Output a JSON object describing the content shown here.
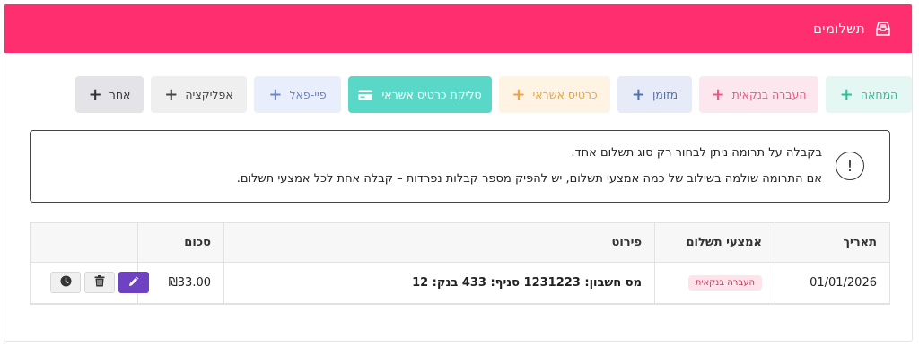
{
  "header": {
    "title": "תשלומים",
    "icon": "inbox-tray-icon",
    "color": "#ff2e6f"
  },
  "payment_buttons": [
    {
      "label": "המחאה",
      "name": "cheque",
      "bg": "#e4f7f3",
      "fg": "#2fbf97"
    },
    {
      "label": "העברה בנקאית",
      "name": "bank-transfer",
      "bg": "#fde7ee",
      "fg": "#e75a86"
    },
    {
      "label": "מזומן",
      "name": "cash",
      "bg": "#e6ebf7",
      "fg": "#5470a8"
    },
    {
      "label": "כרטיס אשראי",
      "name": "credit-card",
      "bg": "#fff4e4",
      "fg": "#e9a448"
    },
    {
      "label": "סליקת כרטיס אשראי",
      "name": "credit-card-clearing",
      "bg": "#59d8c8",
      "fg": "#ffffff"
    },
    {
      "label": "פיי-פאל",
      "name": "paypal",
      "bg": "#e8eefb",
      "fg": "#6f86c9"
    },
    {
      "label": "אפליקציה",
      "name": "app",
      "bg": "#efefef",
      "fg": "#444444"
    },
    {
      "label": "אחר",
      "name": "other",
      "bg": "#e4e4e8",
      "fg": "#333333"
    }
  ],
  "alert": {
    "line1": "בקבלה על תרומה ניתן לבחור רק סוג תשלום אחד.",
    "line2": "אם התרומה שולמה בשילוב של כמה אמצעי תשלום, יש להפיק מספר קבלות נפרדות – קבלה אחת לכל אמצעי תשלום."
  },
  "table": {
    "headers": {
      "date": "תאריך",
      "method": "אמצעי תשלום",
      "detail": "פירוט",
      "sum": "סכום"
    },
    "rows": [
      {
        "date": "01/01/2026",
        "method": "העברה בנקאית",
        "detail": "מס חשבון: 1231223 סניף: 433 בנק: 12",
        "sum": "₪33.00"
      }
    ]
  }
}
